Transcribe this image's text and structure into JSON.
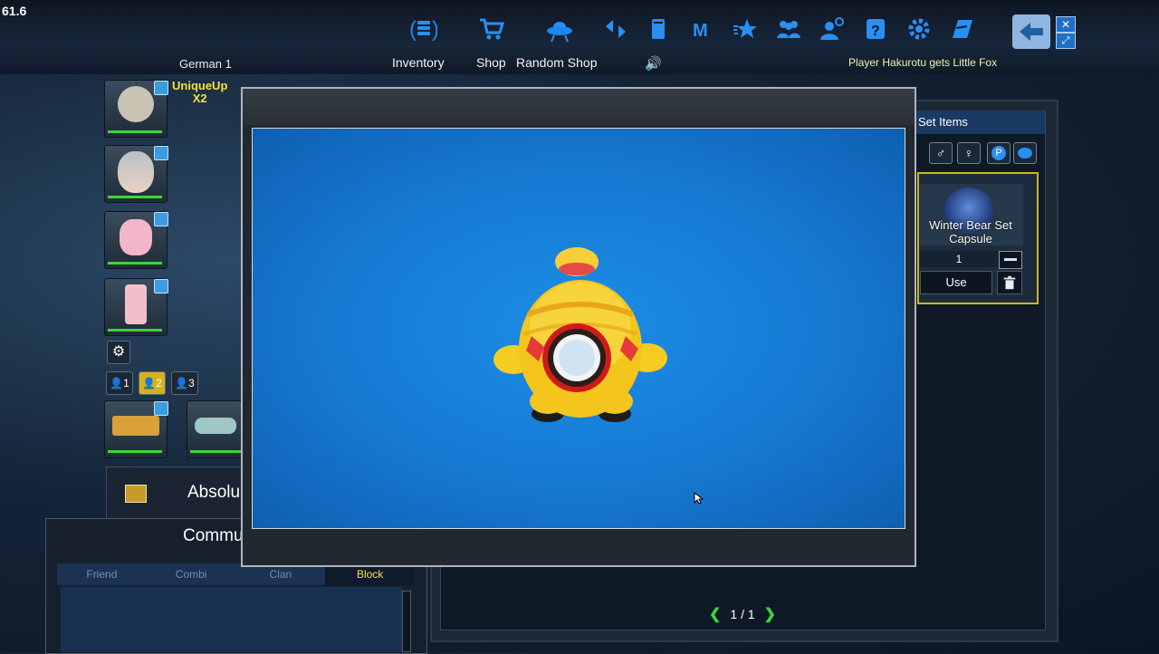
{
  "fps": "61.6",
  "server": "German 1",
  "top_menu": [
    {
      "label": "Inventory",
      "icon": "inventory-icon"
    },
    {
      "label": "Shop",
      "icon": "shop-cart-icon"
    },
    {
      "label": "Random Shop",
      "icon": "ufo-icon"
    }
  ],
  "ticker": "Player Hakurotu  gets Little Fox",
  "unique_up": {
    "line1": "UniqueUp",
    "line2": "X2"
  },
  "preset_buttons": [
    "1",
    "2",
    "3"
  ],
  "absolute_label": "Absolu",
  "community": {
    "title": "Community",
    "tabs": [
      "Friend",
      "Combi",
      "Clan",
      "Block"
    ],
    "active_tab": "Block"
  },
  "inventory": {
    "section_title": "Set Items",
    "item": {
      "name": "Winter Bear Set Capsule",
      "quantity": "1"
    },
    "use_label": "Use",
    "page": "1 / 1"
  },
  "colors": {
    "preview_bg": "#1679d2",
    "capsule_yellow": "#f2c21e",
    "accent_gold": "#d3b41f"
  }
}
